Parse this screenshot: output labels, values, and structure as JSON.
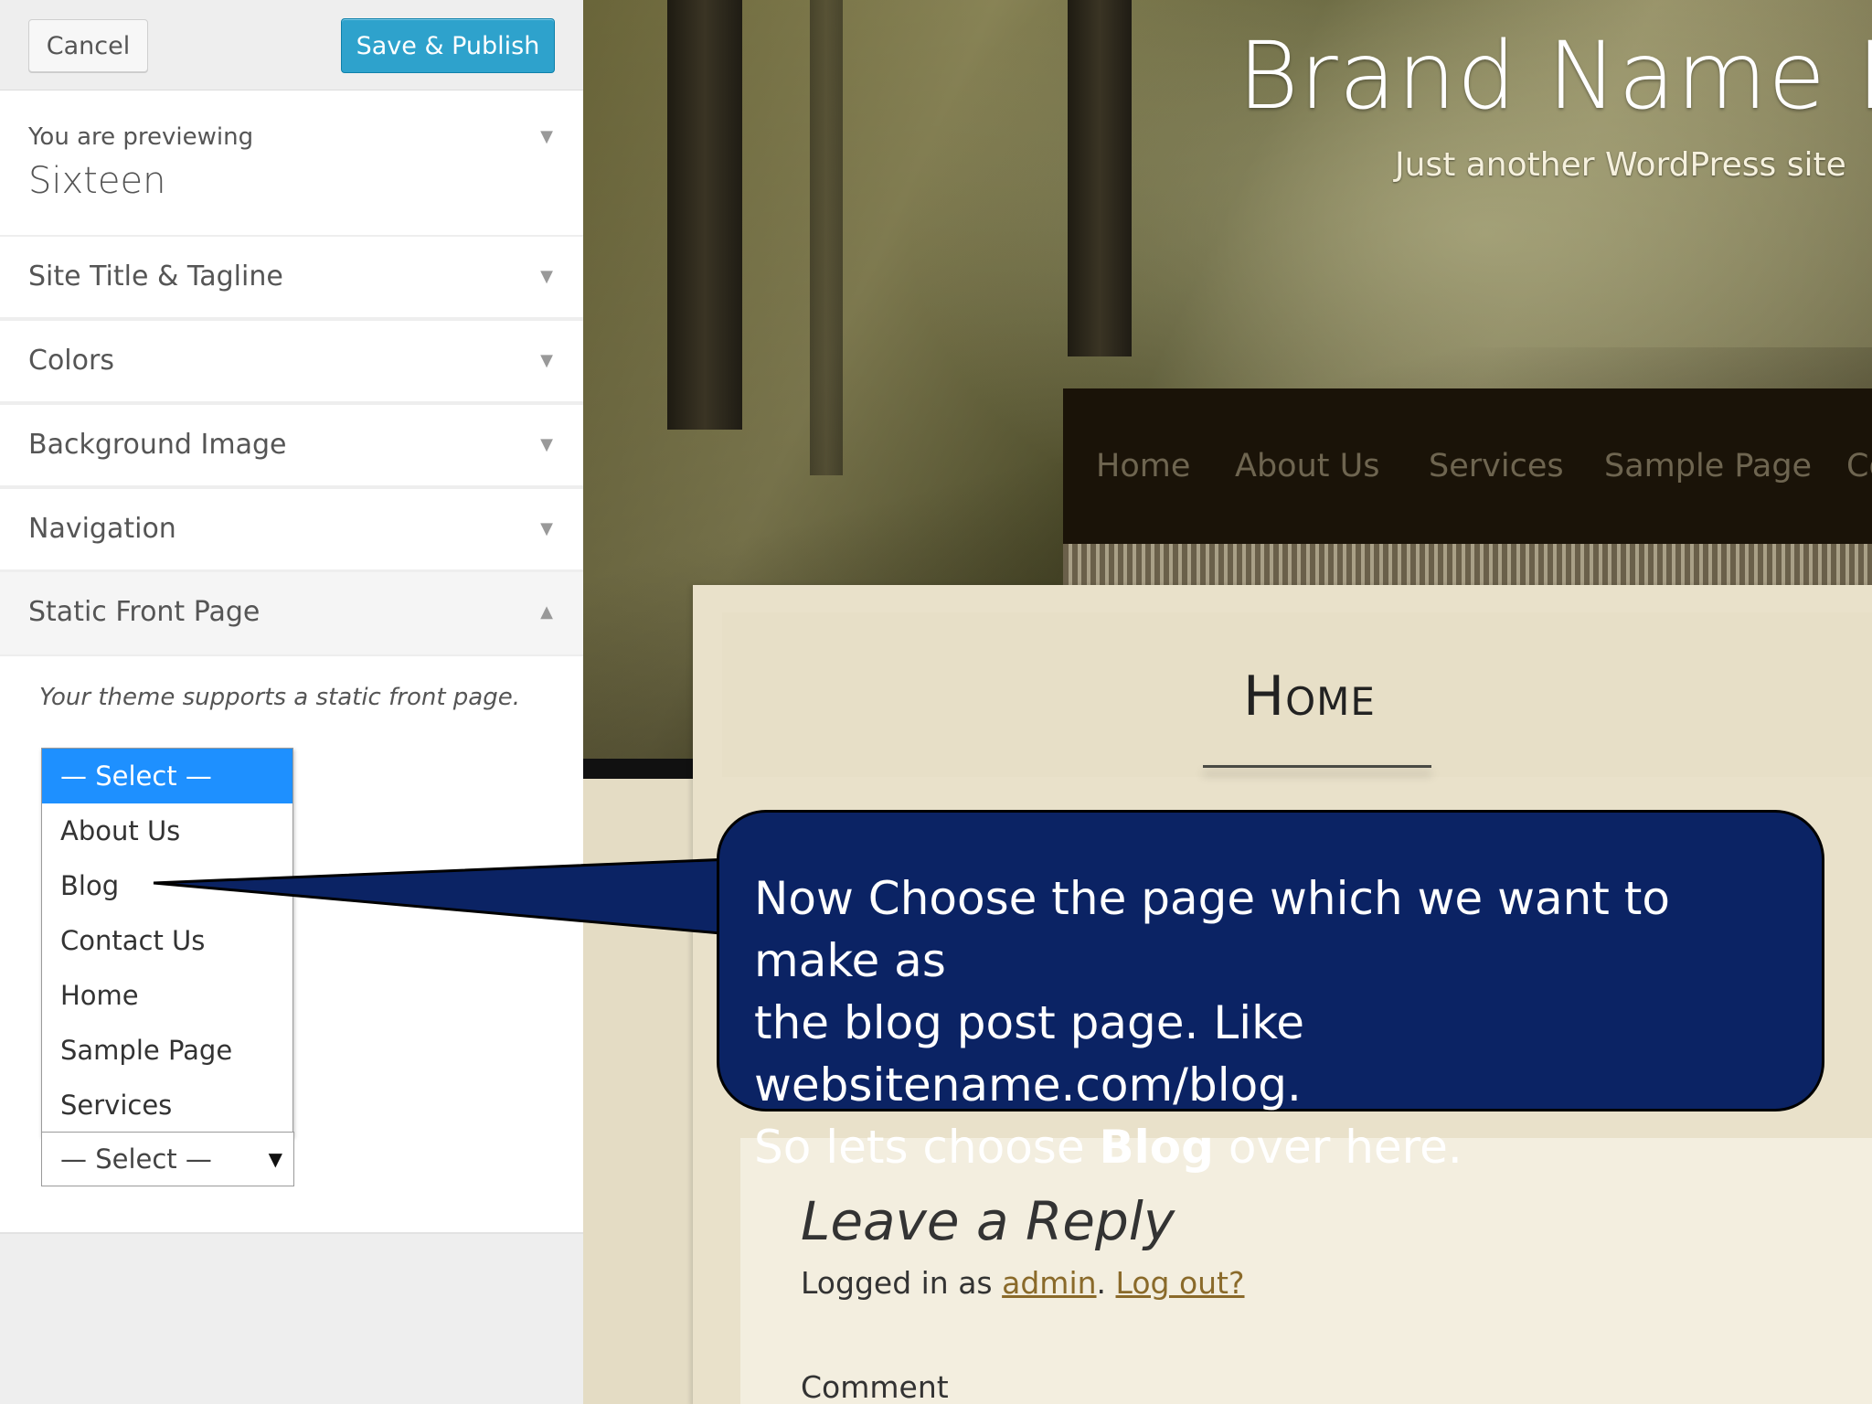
{
  "customizer": {
    "cancel_label": "Cancel",
    "save_label": "Save & Publish",
    "previewing_label": "You are previewing",
    "theme_name": "Sixteen",
    "sections": [
      {
        "label": "Site Title & Tagline"
      },
      {
        "label": "Colors"
      },
      {
        "label": "Background Image"
      },
      {
        "label": "Navigation"
      },
      {
        "label": "Static Front Page"
      }
    ],
    "static_front_page": {
      "description": "Your theme supports a static front page.",
      "dropdown_options": [
        "— Select —",
        "About Us",
        "Blog",
        "Contact Us",
        "Home",
        "Sample Page",
        "Services"
      ],
      "selected_option": "— Select —",
      "bottom_select_value": "— Select —"
    }
  },
  "site": {
    "title": "Brand Name Lo",
    "tagline": "Just another WordPress site",
    "nav": [
      "Home",
      "About Us",
      "Services",
      "Sample Page",
      "Co"
    ],
    "page_heading": "Home",
    "reply_title": "Leave a Reply",
    "logged_in_prefix": "Logged in as",
    "admin_link": "admin",
    "logout_link": "Log out?",
    "comment_label": "Comment"
  },
  "callout": {
    "line1": "Now Choose the page which we want to make as",
    "line2": "the blog post page. Like websitename.com/blog.",
    "line3_prefix": "So lets choose",
    "line3_bold": "Blog",
    "line3_suffix": "over here.",
    "fill_color": "#0b2364"
  }
}
